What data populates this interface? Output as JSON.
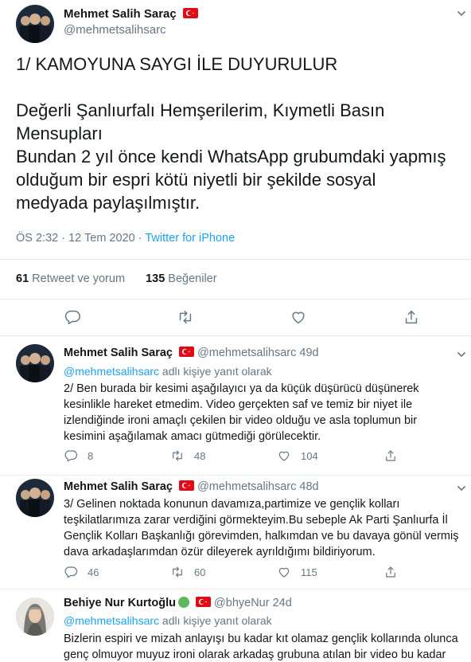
{
  "main_tweet": {
    "author_name": "Mehmet Salih Saraç",
    "author_handle": "@mehmetsalihsarc",
    "text_lines": [
      "1/ KAMOYUNA SAYGI İLE DUYURULUR",
      "",
      "Değerli Şanlıurfalı Hemşerilerim, Kıymetli Basın",
      "Mensupları",
      "Bundan 2 yıl önce kendi WhatsApp grubumdaki yapmış",
      "olduğum bir espri kötü niyetli bir şekilde sosyal",
      "medyada paylaşılmıştır."
    ],
    "time": "ÖS 2:32",
    "date": "12 Tem 2020",
    "separator": "·",
    "source": "Twitter for iPhone",
    "retweet_count": "61",
    "retweet_label": "Retweet ve yorum",
    "like_count": "135",
    "like_label": "Beğeniler"
  },
  "replies": [
    {
      "author_name": "Mehmet Salih Saraç",
      "author_handle": "@mehmetsalihsarc",
      "age": "49d",
      "replying_to": "@mehmetsalihsarc",
      "replying_suffix": "adlı kişiye yanıt olarak",
      "text_lines": [
        "2/ Ben burada bir kesimi aşağılayıcı ya da küçük düşürücü düşünerek",
        "kesinlikle hareket etmedim. Video gerçekten saf ve temiz bir niyet ile",
        "izlendiğinde ironi amaçlı çekilen bir video olduğu ve asla toplumun bir",
        "kesimini aşağılamak amacı gütmediği görülecektir."
      ],
      "replies_count": "8",
      "retweets_count": "48",
      "likes_count": "104"
    },
    {
      "author_name": "Mehmet Salih Saraç",
      "author_handle": "@mehmetsalihsarc",
      "age": "48d",
      "text_lines": [
        "3/ Gelinen noktada konunun davamıza,partimize ve gençlik kolları",
        "teşkilatlarımıza zarar verdiğini görmekteyim.Bu sebeple Ak Parti Şanlıurfa İl",
        "Gençlik Kolları Başkanlığı görevimden, halkımdan ve bu davaya gönül vermiş",
        "dava arkadaşlarımdan özür dileyerek ayrıldığımı bildiriyorum."
      ],
      "replies_count": "46",
      "retweets_count": "60",
      "likes_count": "115"
    },
    {
      "author_name": "Behiye Nur Kurtoğlu",
      "author_handle": "@bhyeNur",
      "age": "24d",
      "replying_to": "@mehmetsalihsarc",
      "replying_suffix": "adlı kişiye yanıt olarak",
      "text_lines": [
        "Bizlerin espiri ve mizah anlayışı bu kadar kıt olamaz gençlik kollarında olunca",
        "genç olmuyor muyuz ironi olarak arkadaş grubuna atılan bir video bu kadar"
      ]
    }
  ],
  "icons": {
    "reply": "speech-bubble-icon",
    "retweet": "retweet-arrows-icon",
    "like": "heart-icon",
    "share": "share-upload-icon",
    "menu": "chevron-down-icon",
    "flag": "turkey-flag-icon"
  },
  "colors": {
    "link": "#1da1f2",
    "secondary_text": "#657786",
    "divider": "#e6ecf0",
    "flag_red": "#e30a17"
  }
}
